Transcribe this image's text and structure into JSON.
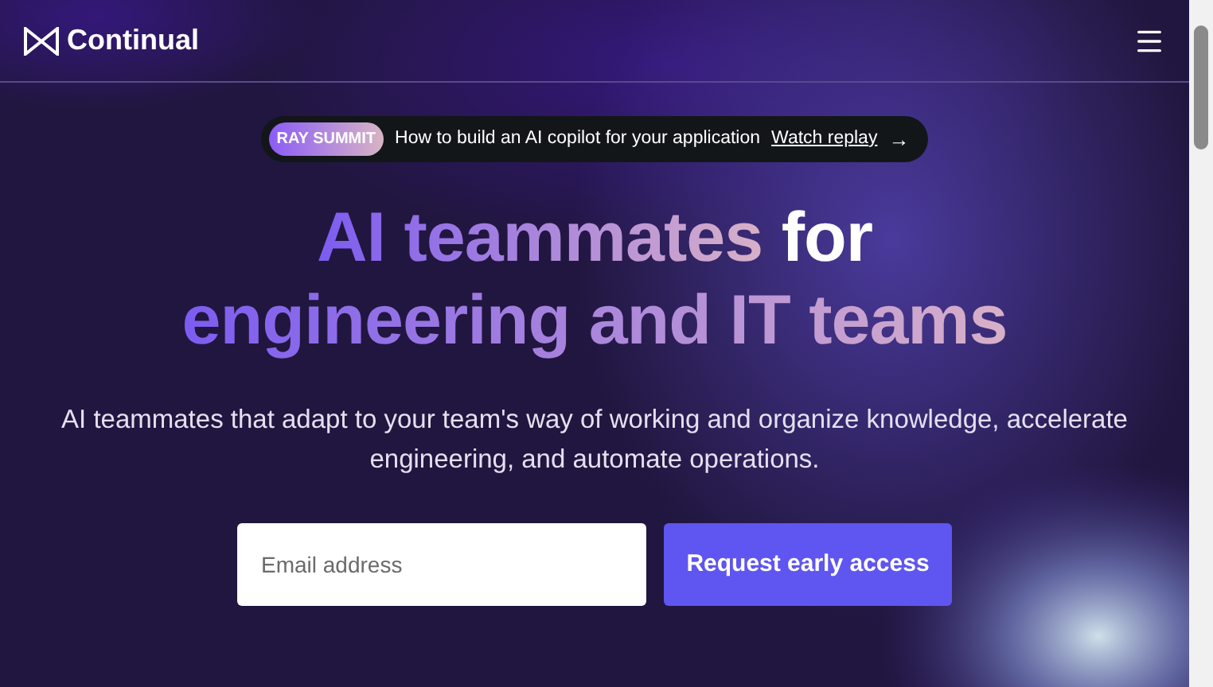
{
  "nav": {
    "logo": "Continual"
  },
  "announcement": {
    "badge": "RAY SUMMIT",
    "text": "How to build an AI copilot for your application",
    "link": "Watch replay",
    "arrow": "→"
  },
  "headline": {
    "lines": [
      [
        {
          "text": "AI teammates",
          "kind": "gradient"
        },
        {
          "text": " for",
          "kind": "plain"
        }
      ],
      [
        {
          "text": "engineering and IT teams",
          "kind": "gradient"
        }
      ]
    ]
  },
  "subtitle": "AI teammates that adapt to your team's way of working and organize knowledge, accelerate engineering, and automate operations.",
  "signup": {
    "placeholder": "Email address",
    "button": "Request early access"
  }
}
